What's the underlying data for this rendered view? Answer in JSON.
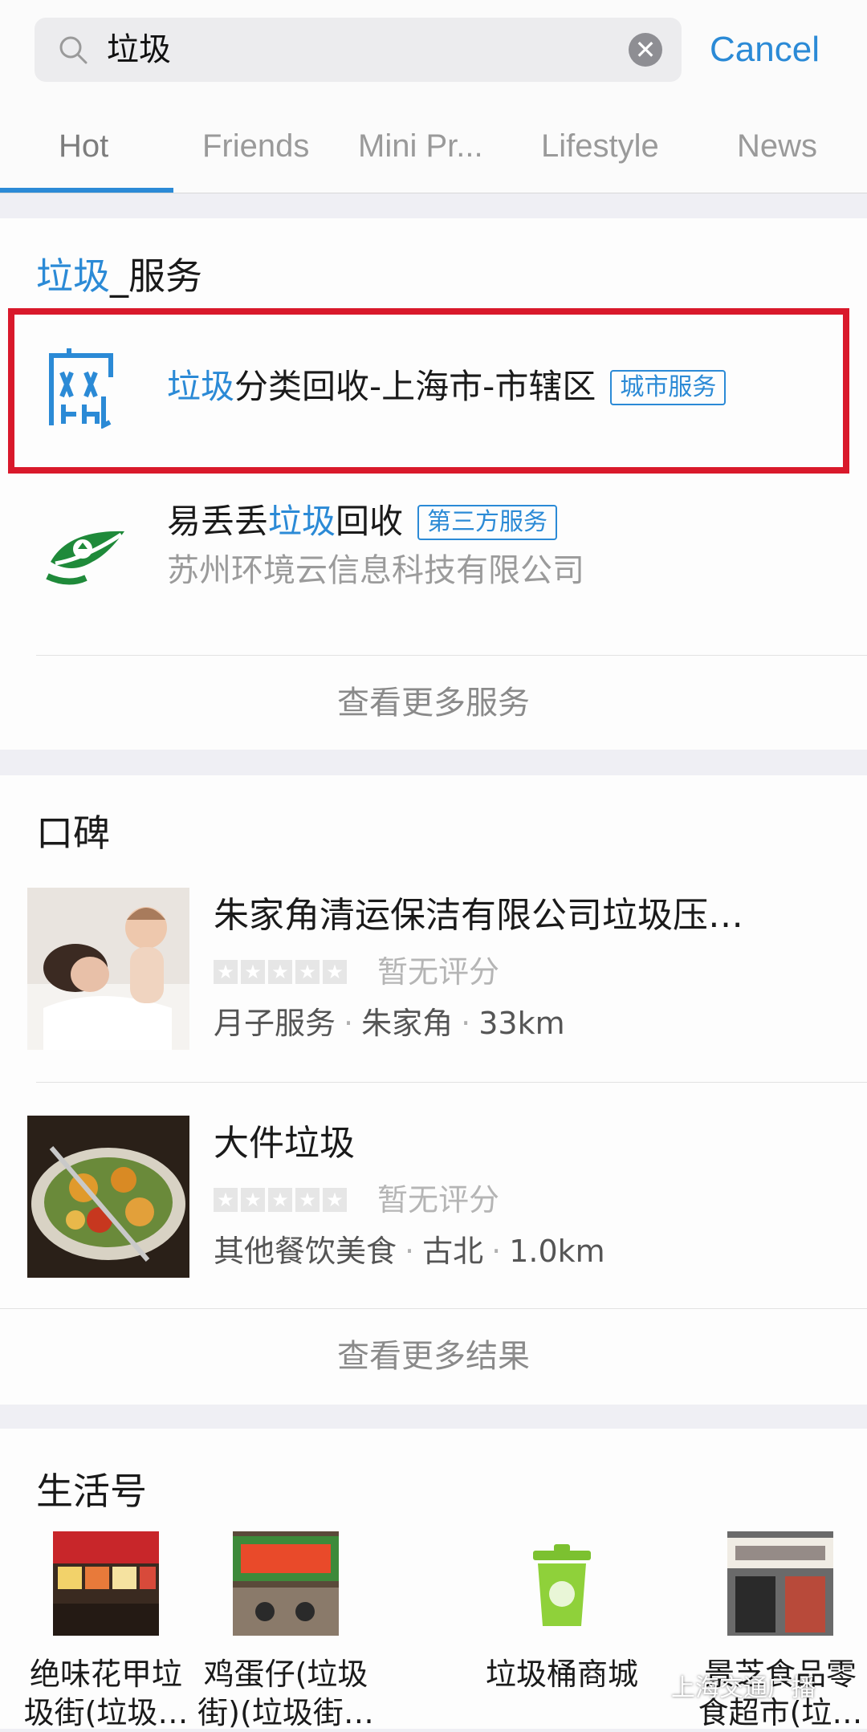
{
  "search": {
    "query": "垃圾",
    "cancel_label": "Cancel"
  },
  "tabs": [
    {
      "label": "Hot"
    },
    {
      "label": "Friends"
    },
    {
      "label": "Mini Pr..."
    },
    {
      "label": "Lifestyle"
    },
    {
      "label": "News"
    }
  ],
  "services_section": {
    "title_highlight": "垃圾",
    "title_rest": "_服务",
    "items": [
      {
        "title_highlight": "垃圾",
        "title_rest": "分类回收-上海市-市辖区",
        "badge": "城市服务"
      },
      {
        "title_prefix": "易丢丢",
        "title_highlight": "垃圾",
        "title_rest": "回收",
        "badge": "第三方服务",
        "subtitle": "苏州环境云信息科技有限公司"
      }
    ],
    "more_label": "查看更多服务"
  },
  "koubei_section": {
    "title": "口碑",
    "items": [
      {
        "title": "朱家角清运保洁有限公司垃圾压…",
        "rating_text": "暂无评分",
        "category": "月子服务",
        "area": "朱家角",
        "distance": "33km"
      },
      {
        "title": "大件垃圾",
        "rating_text": "暂无评分",
        "category": "其他餐饮美食",
        "area": "古北",
        "distance": "1.0km"
      }
    ],
    "more_label": "查看更多结果"
  },
  "life_section": {
    "title": "生活号",
    "items": [
      {
        "line1": "绝味花甲垃",
        "line2": "圾街(垃圾…"
      },
      {
        "line1": "鸡蛋仔(垃圾",
        "line2": "街)(垃圾街…"
      },
      {
        "line1": "垃圾桶商城",
        "line2": ""
      },
      {
        "line1": "景芝食品零",
        "line2": "食超市(垃…"
      }
    ]
  },
  "watermark": "上海交通广播",
  "colors": {
    "accent": "#2b8ad6",
    "highlight_frame": "#d9192b"
  }
}
